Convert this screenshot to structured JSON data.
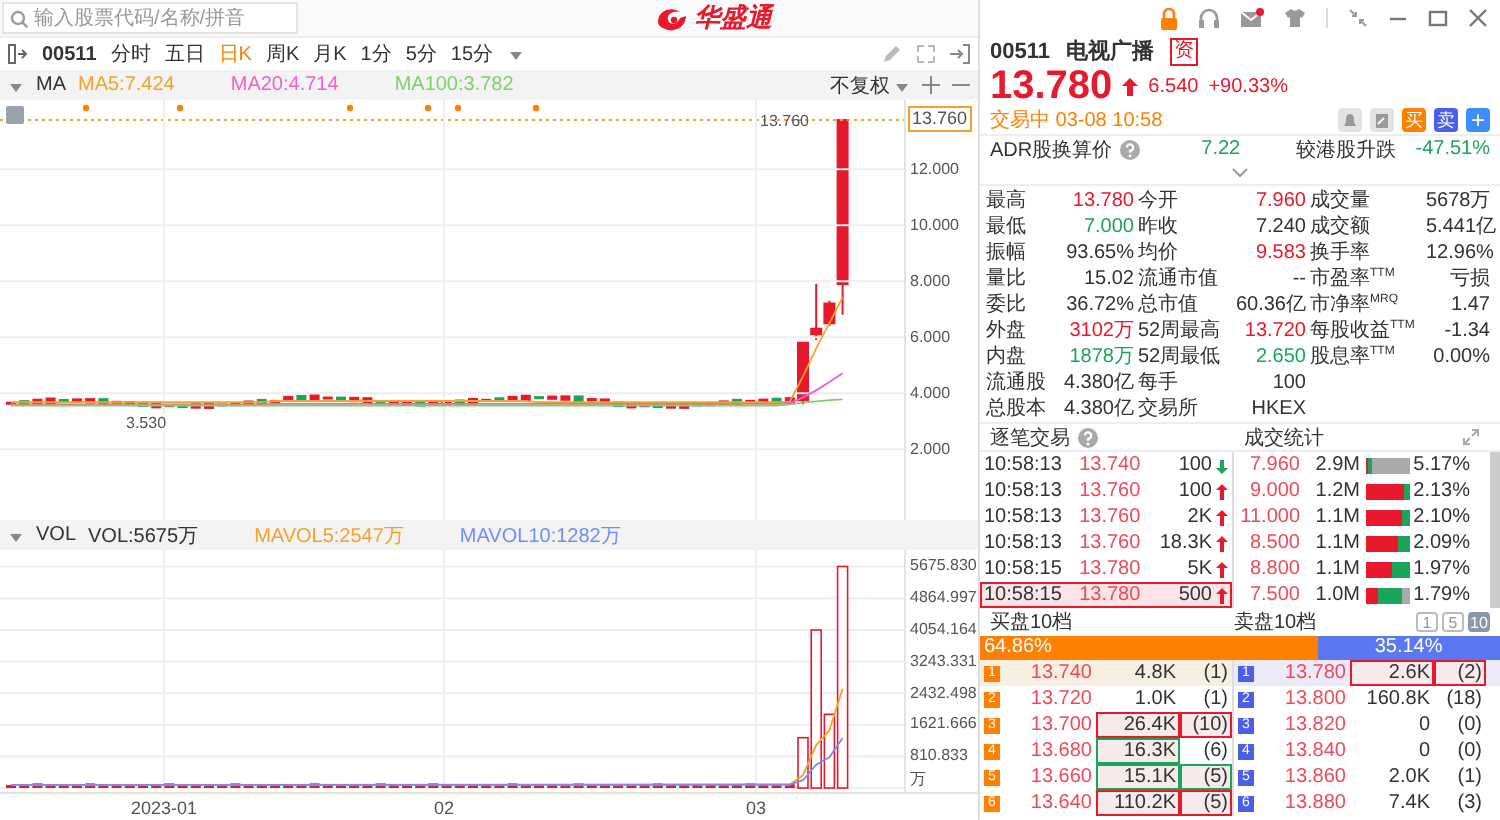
{
  "search": {
    "placeholder": "输入股票代码/名称/拼音"
  },
  "logo": {
    "text": "华盛通"
  },
  "chart_toolbar": {
    "code": "00511",
    "periods": [
      {
        "label": "分时",
        "selected": false
      },
      {
        "label": "五日",
        "selected": false
      },
      {
        "label": "日K",
        "selected": true
      },
      {
        "label": "周K",
        "selected": false
      },
      {
        "label": "月K",
        "selected": false
      },
      {
        "label": "1分",
        "selected": false
      },
      {
        "label": "5分",
        "selected": false
      },
      {
        "label": "15分",
        "selected": false
      }
    ]
  },
  "ma_bar": {
    "title": "MA",
    "items": [
      {
        "label": "MA5:7.424",
        "color": "#f7a128"
      },
      {
        "label": "MA20:4.714",
        "color": "#f25fd0"
      },
      {
        "label": "MA100:3.782",
        "color": "#7fd06a"
      }
    ],
    "adjust": "不复权"
  },
  "price_chart": {
    "current": "13.760",
    "high_label": "13.760",
    "low_label": "3.530",
    "chart_data": {
      "type": "line",
      "ylim": [
        -0.53,
        14.47
      ],
      "grid": true,
      "yticks": [
        {
          "value": 12,
          "label": "12.000"
        },
        {
          "value": 10,
          "label": "10.000"
        },
        {
          "value": 8,
          "label": "8.000"
        },
        {
          "value": 6,
          "label": "6.000"
        },
        {
          "value": 4,
          "label": "4.000"
        },
        {
          "value": 2,
          "label": "2.000"
        }
      ],
      "series": [
        {
          "color": "#f7a128",
          "values": [
            3.68,
            3.68,
            3.68,
            3.68,
            3.68,
            3.68,
            3.68,
            3.68,
            3.68,
            3.68,
            3.68,
            3.68,
            3.68,
            3.68,
            3.68,
            3.68,
            3.68,
            3.68,
            3.68,
            3.68,
            3.72,
            3.72,
            3.72,
            3.72,
            3.72,
            3.72,
            3.72,
            3.72,
            3.72,
            3.72,
            3.72,
            3.72,
            3.72,
            3.72,
            3.72,
            3.72,
            3.72,
            3.72,
            3.72,
            3.72,
            3.68,
            3.68,
            3.68,
            3.68,
            3.68,
            3.68,
            3.68,
            3.68,
            3.68,
            3.68,
            3.68,
            3.68,
            3.68,
            3.68,
            3.68,
            3.68,
            3.68,
            3.68,
            3.68,
            3.7,
            4.6,
            5.6,
            6.5,
            7.42
          ]
        },
        {
          "color": "#f25fd0",
          "values": [
            3.6,
            3.6,
            3.6,
            3.6,
            3.6,
            3.6,
            3.6,
            3.6,
            3.6,
            3.6,
            3.6,
            3.6,
            3.6,
            3.6,
            3.6,
            3.6,
            3.6,
            3.6,
            3.6,
            3.6,
            3.62,
            3.62,
            3.62,
            3.62,
            3.62,
            3.62,
            3.62,
            3.62,
            3.62,
            3.62,
            3.62,
            3.62,
            3.62,
            3.62,
            3.62,
            3.62,
            3.62,
            3.62,
            3.62,
            3.62,
            3.62,
            3.62,
            3.62,
            3.62,
            3.62,
            3.62,
            3.62,
            3.62,
            3.62,
            3.62,
            3.62,
            3.62,
            3.62,
            3.62,
            3.62,
            3.62,
            3.62,
            3.62,
            3.62,
            3.65,
            3.85,
            4.1,
            4.4,
            4.71
          ]
        },
        {
          "color": "#7fd06a",
          "values": [
            3.56,
            3.56,
            3.56,
            3.56,
            3.56,
            3.56,
            3.56,
            3.56,
            3.56,
            3.56,
            3.56,
            3.56,
            3.56,
            3.56,
            3.56,
            3.56,
            3.56,
            3.56,
            3.56,
            3.56,
            3.56,
            3.56,
            3.56,
            3.56,
            3.56,
            3.56,
            3.56,
            3.56,
            3.56,
            3.56,
            3.56,
            3.56,
            3.56,
            3.56,
            3.56,
            3.56,
            3.56,
            3.56,
            3.56,
            3.56,
            3.56,
            3.56,
            3.56,
            3.56,
            3.56,
            3.56,
            3.56,
            3.56,
            3.56,
            3.56,
            3.56,
            3.56,
            3.56,
            3.56,
            3.56,
            3.56,
            3.56,
            3.56,
            3.56,
            3.6,
            3.66,
            3.71,
            3.75,
            3.78
          ]
        }
      ]
    }
  },
  "volume_chart": {
    "title": "VOL",
    "items": [
      {
        "label": "VOL:5675万",
        "color": "#333333"
      },
      {
        "label": "MAVOL5:2547万",
        "color": "#f7a128"
      },
      {
        "label": "MAVOL10:1282万",
        "color": "#6e8ff7"
      }
    ],
    "chart_data": {
      "type": "bar",
      "ylim": [
        -102,
        6102
      ],
      "grid": true,
      "yticks": [
        {
          "value": 5675.83,
          "label": "5675.830"
        },
        {
          "value": 4864.997,
          "label": "4864.997"
        },
        {
          "value": 4054.164,
          "label": "4054.164"
        },
        {
          "value": 3243.331,
          "label": "3243.331"
        },
        {
          "value": 2432.498,
          "label": "2432.498"
        },
        {
          "value": 1621.666,
          "label": "1621.666"
        },
        {
          "value": 810.833,
          "label": "810.833"
        },
        {
          "value": 0,
          "label": "万"
        }
      ],
      "series": [
        {
          "color": "#e8192c",
          "values": [
            80,
            80,
            120,
            80,
            80,
            80,
            120,
            80,
            80,
            80,
            80,
            80,
            120,
            80,
            80,
            80,
            80,
            120,
            80,
            80,
            80,
            80,
            80,
            120,
            80,
            80,
            80,
            80,
            120,
            80,
            80,
            80,
            120,
            80,
            80,
            80,
            80,
            80,
            120,
            80,
            80,
            80,
            80,
            120,
            80,
            80,
            80,
            80,
            80,
            120,
            80,
            80,
            80,
            80,
            80,
            80,
            120,
            80,
            80,
            100,
            1290,
            4050,
            1890,
            5680
          ]
        }
      ]
    }
  },
  "date_axis": [
    "2023-01",
    "02",
    "03"
  ],
  "quote": {
    "code": "00511",
    "name": "电视广播",
    "badge": "资",
    "price": "13.780",
    "rising": true,
    "change": "6.540",
    "change_pct": "+90.33%",
    "status": "交易中 03-08 10:58",
    "actions": [
      {
        "kind": "alert"
      },
      {
        "kind": "note"
      },
      {
        "kind": "buy",
        "label": "买"
      },
      {
        "kind": "sell",
        "label": "卖"
      },
      {
        "kind": "add",
        "label": "+"
      }
    ]
  },
  "adr": {
    "label": "ADR股换算价",
    "value": "7.22",
    "compare_label": "较港股升跌",
    "compare_value": "-47.51%"
  },
  "stats": [
    [
      {
        "label": "最高",
        "value": "13.780",
        "color": "#e8192c"
      },
      {
        "label": "今开",
        "value": "7.960",
        "color": "#e8192c"
      },
      {
        "label": "成交量",
        "value": "5678万",
        "color": "#333333"
      }
    ],
    [
      {
        "label": "最低",
        "value": "7.000",
        "color": "#1aa55a"
      },
      {
        "label": "昨收",
        "value": "7.240",
        "color": "#333333"
      },
      {
        "label": "成交额",
        "value": "5.441亿",
        "color": "#333333"
      }
    ],
    [
      {
        "label": "振幅",
        "value": "93.65%",
        "color": "#333333"
      },
      {
        "label": "均价",
        "value": "9.583",
        "color": "#e8192c"
      },
      {
        "label": "换手率",
        "value": "12.96%",
        "color": "#333333"
      }
    ],
    [
      {
        "label": "量比",
        "value": "15.02",
        "color": "#333333"
      },
      {
        "label": "流通市值",
        "value": "--",
        "color": "#333333"
      },
      {
        "label": "市盈率$^{TTM}$",
        "value": "亏损",
        "color": "#333333"
      }
    ],
    [
      {
        "label": "委比",
        "value": "36.72%",
        "color": "#333333"
      },
      {
        "label": "总市值",
        "value": "60.36亿",
        "color": "#333333"
      },
      {
        "label": "市净率$^{MRQ}$",
        "value": "1.47",
        "color": "#333333"
      }
    ],
    [
      {
        "label": "外盘",
        "value": "3102万",
        "color": "#e8192c"
      },
      {
        "label": "52周最高",
        "value": "13.720",
        "color": "#e8192c"
      },
      {
        "label": "每股收益$^{TTM}$",
        "value": "-1.34",
        "color": "#333333"
      }
    ],
    [
      {
        "label": "内盘",
        "value": "1878万",
        "color": "#1aa55a"
      },
      {
        "label": "52周最低",
        "value": "2.650",
        "color": "#1aa55a"
      },
      {
        "label": "股息率$^{TTM}$",
        "value": "0.00%",
        "color": "#333333"
      }
    ],
    [
      {
        "label": "流通股",
        "value": "4.380亿",
        "color": "#333333"
      },
      {
        "label": "每手",
        "value": "100",
        "color": "#333333"
      }
    ],
    [
      {
        "label": "总股本",
        "value": "4.380亿",
        "color": "#333333"
      },
      {
        "label": "交易所",
        "value": "HKEX",
        "color": "#333333"
      }
    ]
  ],
  "trades": {
    "title": "逐笔交易",
    "rows": [
      {
        "time": "10:58:13",
        "price": "13.740",
        "volume": "100",
        "rising": false,
        "selected": false
      },
      {
        "time": "10:58:13",
        "price": "13.760",
        "volume": "100",
        "rising": true,
        "selected": false
      },
      {
        "time": "10:58:13",
        "price": "13.760",
        "volume": "2K",
        "rising": true,
        "selected": false
      },
      {
        "time": "10:58:13",
        "price": "13.760",
        "volume": "18.3K",
        "rising": true,
        "selected": false
      },
      {
        "time": "10:58:15",
        "price": "13.780",
        "volume": "5K",
        "rising": true,
        "selected": false
      },
      {
        "time": "10:58:15",
        "price": "13.780",
        "volume": "500",
        "rising": true,
        "selected": true
      }
    ]
  },
  "volume_stats": {
    "title": "成交统计",
    "rows": [
      {
        "price": "7.960",
        "volume": "2.9M",
        "share": "5.17%",
        "buy": {
          "level": 0.05
        },
        "total": {
          "level": 0.13
        }
      },
      {
        "price": "9.000",
        "volume": "1.2M",
        "share": "2.13%",
        "buy": {
          "level": 0.85
        },
        "total": {
          "level": 1
        }
      },
      {
        "price": "11.000",
        "volume": "1.1M",
        "share": "2.10%",
        "buy": {
          "level": 0.8
        },
        "total": {
          "level": 1
        }
      },
      {
        "price": "8.500",
        "volume": "1.1M",
        "share": "2.09%",
        "buy": {
          "level": 0.72
        },
        "total": {
          "level": 1
        }
      },
      {
        "price": "8.800",
        "volume": "1.1M",
        "share": "1.97%",
        "buy": {
          "level": 0.58
        },
        "total": {
          "level": 1
        }
      },
      {
        "price": "7.500",
        "volume": "1.0M",
        "share": "1.79%",
        "buy": {
          "level": 0.25
        },
        "total": {
          "level": 0.8
        }
      }
    ]
  },
  "order_book": {
    "bid_title": "买盘10档",
    "ask_title": "卖盘10档",
    "depth_tabs": [
      {
        "label": "1",
        "selected": false
      },
      {
        "label": "5",
        "selected": false
      },
      {
        "label": "10",
        "selected": true
      }
    ],
    "bid_share": {
      "label": "64.86%",
      "level": 0.6486
    },
    "ask_share": {
      "label": "35.14%"
    },
    "bids": [
      {
        "index": "1",
        "price": "13.740",
        "volume": {
          "text": "4.8K"
        },
        "count": {
          "text": "(1)"
        }
      },
      {
        "index": "2",
        "price": "13.720",
        "volume": {
          "text": "1.0K"
        },
        "count": {
          "text": "(1)"
        }
      },
      {
        "index": "3",
        "price": "13.700",
        "volume": {
          "text": "26.4K",
          "color": "#e8192c"
        },
        "count": {
          "text": "(10)",
          "color": "#e8192c"
        }
      },
      {
        "index": "4",
        "price": "13.680",
        "volume": {
          "text": "16.3K",
          "color": "#1aa55a"
        },
        "count": {
          "text": "(6)"
        }
      },
      {
        "index": "5",
        "price": "13.660",
        "volume": {
          "text": "15.1K",
          "color": "#1aa55a"
        },
        "count": {
          "text": "(5)",
          "color": "#1aa55a"
        }
      },
      {
        "index": "6",
        "price": "13.640",
        "volume": {
          "text": "110.2K",
          "color": "#e8192c"
        },
        "count": {
          "text": "(5)",
          "color": "#e8192c"
        }
      }
    ],
    "asks": [
      {
        "index": "1",
        "price": "13.780",
        "volume": {
          "text": "2.6K",
          "color": "#e8192c"
        },
        "count": {
          "text": "(2)",
          "color": "#e8192c"
        }
      },
      {
        "index": "2",
        "price": "13.800",
        "volume": {
          "text": "160.8K"
        },
        "count": {
          "text": "(18)"
        }
      },
      {
        "index": "3",
        "price": "13.820",
        "volume": {
          "text": "0"
        },
        "count": {
          "text": "(0)"
        }
      },
      {
        "index": "4",
        "price": "13.840",
        "volume": {
          "text": "0"
        },
        "count": {
          "text": "(0)"
        }
      },
      {
        "index": "5",
        "price": "13.860",
        "volume": {
          "text": "2.0K"
        },
        "count": {
          "text": "(1)"
        }
      },
      {
        "index": "6",
        "price": "13.880",
        "volume": {
          "text": "7.4K"
        },
        "count": {
          "text": "(3)"
        }
      }
    ]
  }
}
